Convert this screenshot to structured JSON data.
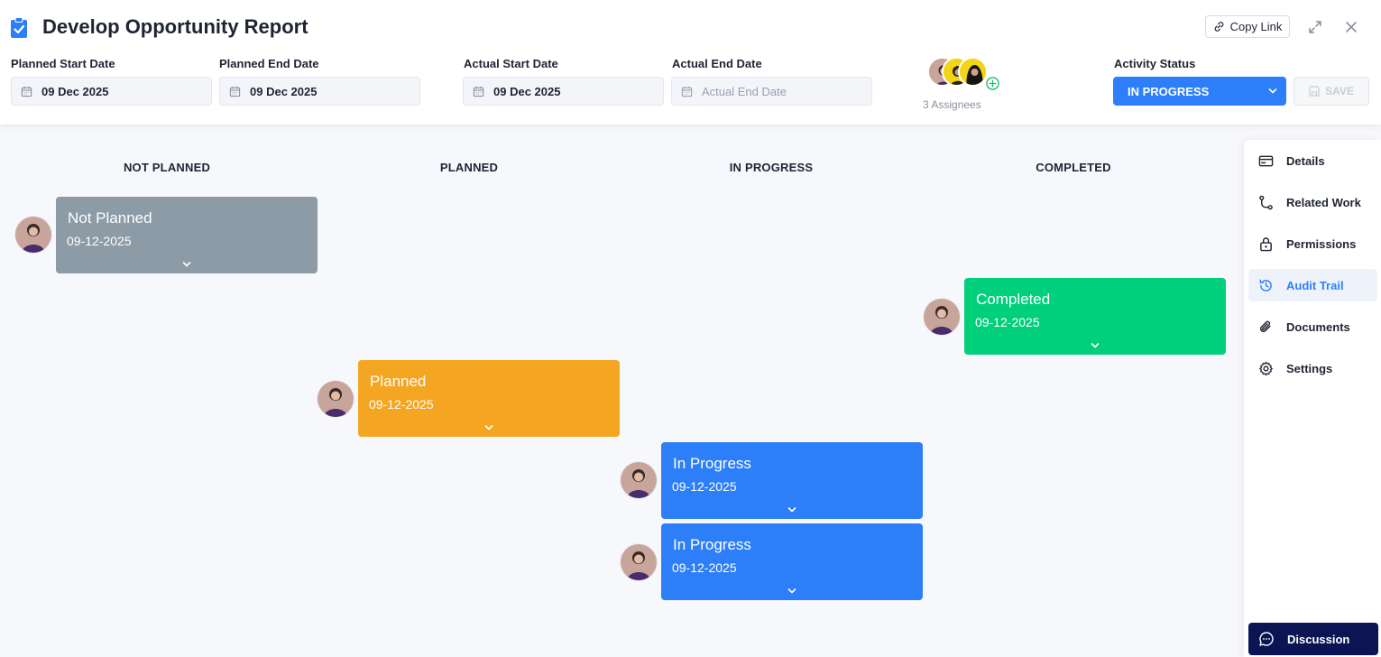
{
  "header": {
    "title": "Develop Opportunity Report",
    "copy_link_label": "Copy Link"
  },
  "dates": {
    "planned_start": {
      "label": "Planned Start Date",
      "value": "09 Dec 2025"
    },
    "planned_end": {
      "label": "Planned End Date",
      "value": "09 Dec 2025"
    },
    "actual_start": {
      "label": "Actual Start Date",
      "value": "09 Dec 2025"
    },
    "actual_end": {
      "label": "Actual End Date",
      "value": "",
      "placeholder": "Actual End Date"
    }
  },
  "assignees": {
    "count_label": "3 Assignees"
  },
  "status": {
    "label": "Activity Status",
    "selected": "IN PROGRESS",
    "save_label": "SAVE"
  },
  "board": {
    "columns": [
      "NOT PLANNED",
      "PLANNED",
      "IN PROGRESS",
      "COMPLETED"
    ],
    "cards": [
      {
        "title": "Not Planned",
        "date": "09-12-2025",
        "color": "#8d9ba6"
      },
      {
        "title": "Completed",
        "date": "09-12-2025",
        "color": "#00d07c"
      },
      {
        "title": "Planned",
        "date": "09-12-2025",
        "color": "#f4a623"
      },
      {
        "title": "In Progress",
        "date": "09-12-2025",
        "color": "#2d7ff9"
      },
      {
        "title": "In Progress",
        "date": "09-12-2025",
        "color": "#2d7ff9"
      }
    ]
  },
  "side_menu": {
    "items": [
      {
        "label": "Details",
        "icon": "card-icon"
      },
      {
        "label": "Related Work",
        "icon": "route-icon"
      },
      {
        "label": "Permissions",
        "icon": "lock-icon"
      },
      {
        "label": "Audit Trail",
        "icon": "history-icon",
        "active": true
      },
      {
        "label": "Documents",
        "icon": "paperclip-icon"
      },
      {
        "label": "Settings",
        "icon": "gear-icon"
      }
    ],
    "discussion_label": "Discussion"
  },
  "colors": {
    "primary": "#2d7ff9",
    "discussion_bg": "#0c1454"
  }
}
